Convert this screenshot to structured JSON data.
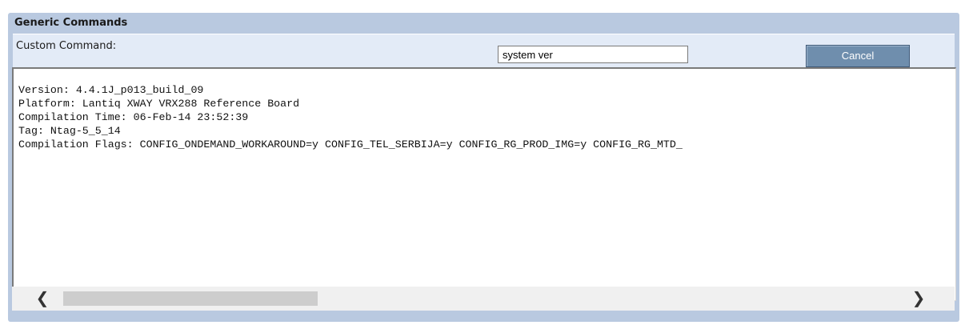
{
  "panel": {
    "title": "Generic Commands"
  },
  "command": {
    "label": "Custom Command:",
    "value": "system ver",
    "cancel_label": "Cancel"
  },
  "output": {
    "lines": [
      "Version: 4.4.1J_p013_build_09",
      "Platform: Lantiq XWAY VRX288 Reference Board",
      "Compilation Time: 06-Feb-14 23:52:39",
      "Tag: Ntag-5_5_14",
      "Compilation Flags: CONFIG_ONDEMAND_WORKAROUND=y CONFIG_TEL_SERBIJA=y CONFIG_RG_PROD_IMG=y CONFIG_RG_MTD_"
    ]
  },
  "scrollbar": {
    "left_icon": "chevron-left-icon",
    "right_icon": "chevron-right-icon",
    "left_glyph": "❮",
    "right_glyph": "❯"
  }
}
